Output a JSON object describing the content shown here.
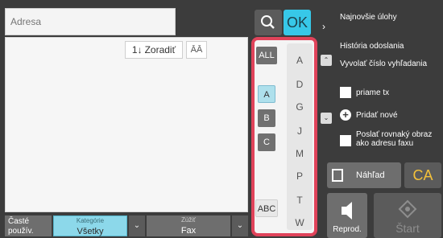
{
  "address": {
    "placeholder": "Adresa"
  },
  "toolbar": {
    "ok_label": "OK",
    "sort_label": "Zoradiť",
    "sort_prefix": "1↓",
    "format_icon_text": "ĀĀ"
  },
  "index": {
    "all_label": "ALL",
    "group_tiles": [
      "A",
      "B",
      "C"
    ],
    "abc_label": "ABC",
    "az_letters": [
      "A",
      "D",
      "G",
      "J",
      "M",
      "P",
      "T",
      "W"
    ]
  },
  "bottom": {
    "frequent_label": "Časté použív.",
    "category_caption": "Kategórie",
    "category_value": "Všetky",
    "filter_caption": "Zúžiť",
    "filter_value": "Fax"
  },
  "right_panel": {
    "latest_jobs": "Najnovšie úlohy",
    "send_history": "História odoslania",
    "recall_search": "Vyvolať číslo vyhľadania",
    "direct_tx": "priame tx",
    "add_new": "Pridať nové",
    "same_image": "Poslať rovnaký obraz ako adresu faxu"
  },
  "actions": {
    "preview": "Náhľad",
    "ca": "CA",
    "reprod": "Reprod.",
    "start": "Štart"
  },
  "colors": {
    "accent": "#37c8e8",
    "index_frame": "#e0435a",
    "ca": "#f4c13a"
  }
}
